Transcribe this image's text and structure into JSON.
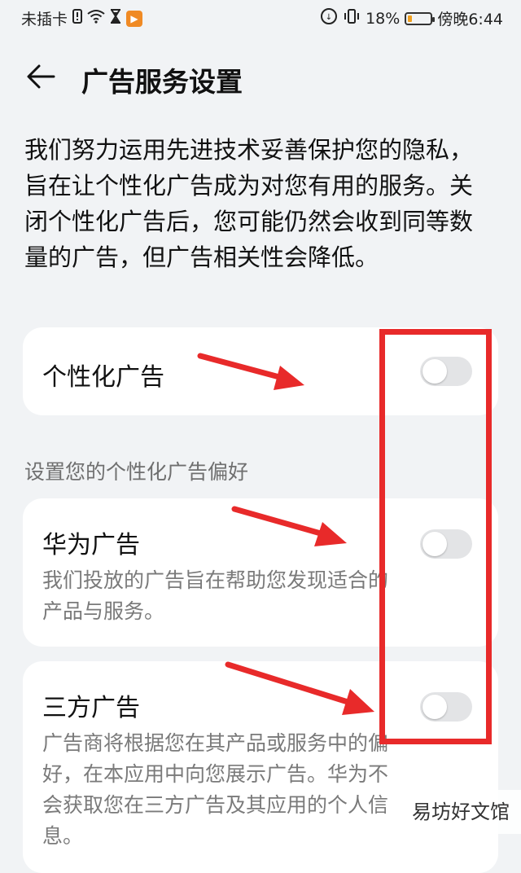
{
  "status_bar": {
    "carrier": "未插卡",
    "battery_percent": "18%",
    "battery_level": 0.18,
    "time": "傍晚6:44",
    "app_badge": "▶"
  },
  "header": {
    "back_icon": "arrow-left-icon",
    "title": "广告服务设置"
  },
  "intro_text": "我们努力运用先进技术妥善保护您的隐私，旨在让个性化广告成为对您有用的服务。关闭个性化广告后，您可能仍然会收到同等数量的广告，但广告相关性会降低。",
  "personalized_ads": {
    "label": "个性化广告",
    "enabled": false
  },
  "preferences_section": {
    "label": "设置您的个性化广告偏好"
  },
  "huawei_ads": {
    "label": "华为广告",
    "description": "我们投放的广告旨在帮助您发现适合的产品与服务。",
    "enabled": false
  },
  "third_party_ads": {
    "label": "三方广告",
    "description": "广告商将根据您在其产品或服务中的偏好，在本应用中向您展示广告。华为不会获取您在三方广告及其应用的个人信息。",
    "enabled": false
  },
  "annotations": {
    "color": "#e82a2a"
  },
  "watermark": "易坊好文馆"
}
